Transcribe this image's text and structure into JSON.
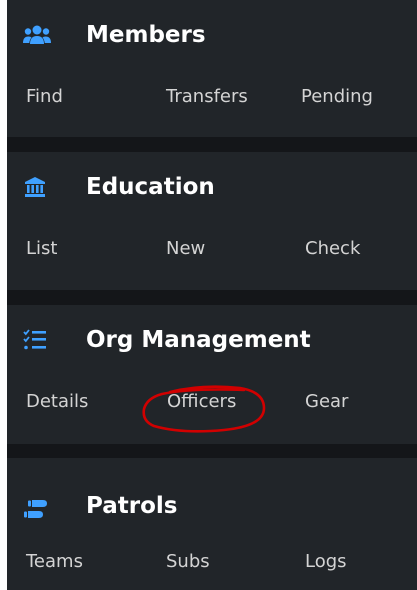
{
  "colors": {
    "accent": "#3fa0ff",
    "panel_bg": "#212529",
    "divider_bg": "#141619",
    "title_text": "#ffffff",
    "link_text": "#d4d4d4",
    "annotation": "#d10000"
  },
  "sections": [
    {
      "title": "Members",
      "icon": "users-icon",
      "links": [
        "Find",
        "Transfers",
        "Pending"
      ]
    },
    {
      "title": "Education",
      "icon": "university-icon",
      "links": [
        "List",
        "New",
        "Check"
      ]
    },
    {
      "title": "Org Management",
      "icon": "list-check-icon",
      "links": [
        "Details",
        "Officers",
        "Gear"
      ]
    },
    {
      "title": "Patrols",
      "icon": "shoe-prints-icon",
      "links": [
        "Teams",
        "Subs",
        "Logs"
      ]
    }
  ],
  "annotation": {
    "type": "hand-drawn-circle",
    "target": "Officers"
  }
}
